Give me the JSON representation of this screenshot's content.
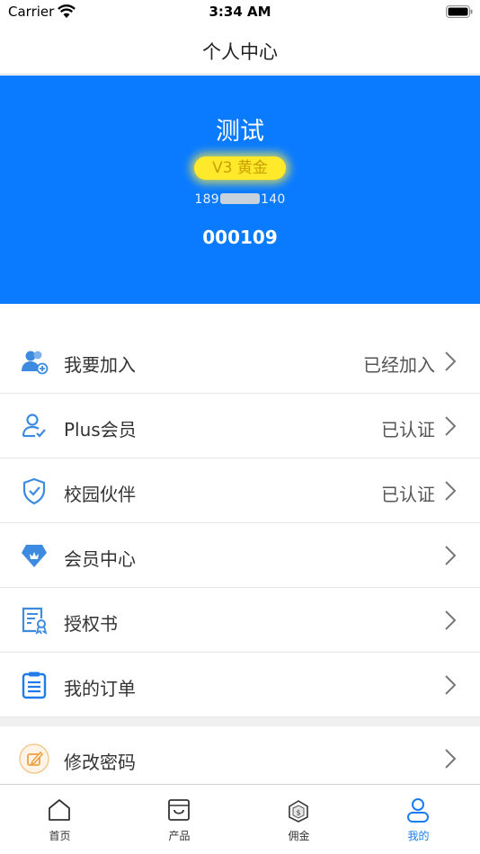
{
  "status_bar": {
    "carrier": "Carrier",
    "time": "3:34 AM"
  },
  "nav": {
    "title": "个人中心"
  },
  "profile": {
    "name": "测试",
    "level": "V3 黄金",
    "phone_prefix": "189",
    "phone_suffix": "140",
    "member_id": "000109",
    "bg_color": "#0a7bff",
    "badge_color": "#ffe92a"
  },
  "menu": {
    "items": [
      {
        "label": "我要加入",
        "value": "已经加入",
        "icon": "user-add-icon"
      },
      {
        "label": "Plus会员",
        "value": "已认证",
        "icon": "user-check-icon"
      },
      {
        "label": "校园伙伴",
        "value": "已认证",
        "icon": "shield-check-icon"
      },
      {
        "label": "会员中心",
        "value": "",
        "icon": "diamond-badge-icon"
      },
      {
        "label": "授权书",
        "value": "",
        "icon": "certificate-icon"
      },
      {
        "label": "我的订单",
        "value": "",
        "icon": "clipboard-icon"
      }
    ],
    "secondary": [
      {
        "label": "修改密码",
        "value": "",
        "icon": "edit-lock-icon"
      }
    ]
  },
  "tabs": [
    {
      "label": "首页",
      "icon": "home-icon"
    },
    {
      "label": "产品",
      "icon": "shopping-bag-icon"
    },
    {
      "label": "佣金",
      "icon": "commission-icon"
    },
    {
      "label": "我的",
      "icon": "person-icon",
      "active": true
    }
  ],
  "colors": {
    "accent": "#1a7cf2",
    "icon_blue": "#3d8be0"
  }
}
